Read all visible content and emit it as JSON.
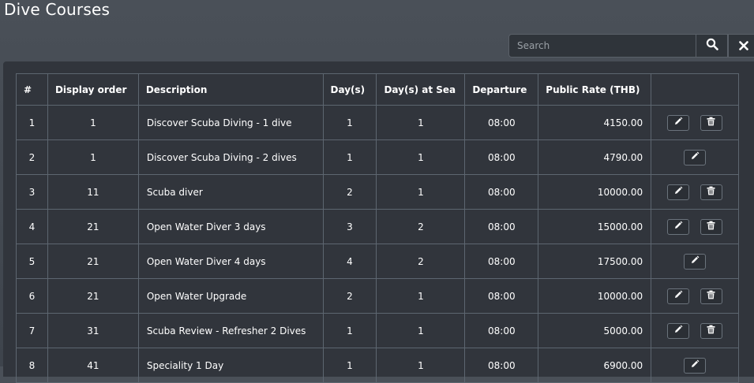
{
  "page": {
    "title": "Dive Courses"
  },
  "search": {
    "placeholder": "Search"
  },
  "icons": {
    "search": "search-icon",
    "clear": "close-icon",
    "edit": "pencil-icon",
    "delete": "trash-icon"
  },
  "table": {
    "headers": [
      "#",
      "Display order",
      "Description",
      "Day(s)",
      "Day(s) at Sea",
      "Departure",
      "Public Rate (THB)",
      ""
    ],
    "rows": [
      {
        "num": "1",
        "order": "1",
        "description": "Discover Scuba Diving - 1 dive",
        "days": "1",
        "days_at_sea": "1",
        "departure": "08:00",
        "rate": "4150.00",
        "deletable": true
      },
      {
        "num": "2",
        "order": "1",
        "description": "Discover Scuba Diving - 2 dives",
        "days": "1",
        "days_at_sea": "1",
        "departure": "08:00",
        "rate": "4790.00",
        "deletable": false
      },
      {
        "num": "3",
        "order": "11",
        "description": "Scuba diver",
        "days": "2",
        "days_at_sea": "1",
        "departure": "08:00",
        "rate": "10000.00",
        "deletable": true
      },
      {
        "num": "4",
        "order": "21",
        "description": "Open Water Diver 3 days",
        "days": "3",
        "days_at_sea": "2",
        "departure": "08:00",
        "rate": "15000.00",
        "deletable": true
      },
      {
        "num": "5",
        "order": "21",
        "description": "Open Water Diver 4 days",
        "days": "4",
        "days_at_sea": "2",
        "departure": "08:00",
        "rate": "17500.00",
        "deletable": false
      },
      {
        "num": "6",
        "order": "21",
        "description": "Open Water Upgrade",
        "days": "2",
        "days_at_sea": "1",
        "departure": "08:00",
        "rate": "10000.00",
        "deletable": true
      },
      {
        "num": "7",
        "order": "31",
        "description": "Scuba Review - Refresher 2 Dives",
        "days": "1",
        "days_at_sea": "1",
        "departure": "08:00",
        "rate": "5000.00",
        "deletable": true
      },
      {
        "num": "8",
        "order": "41",
        "description": "Speciality 1 Day",
        "days": "1",
        "days_at_sea": "1",
        "departure": "08:00",
        "rate": "6900.00",
        "deletable": false
      }
    ]
  }
}
